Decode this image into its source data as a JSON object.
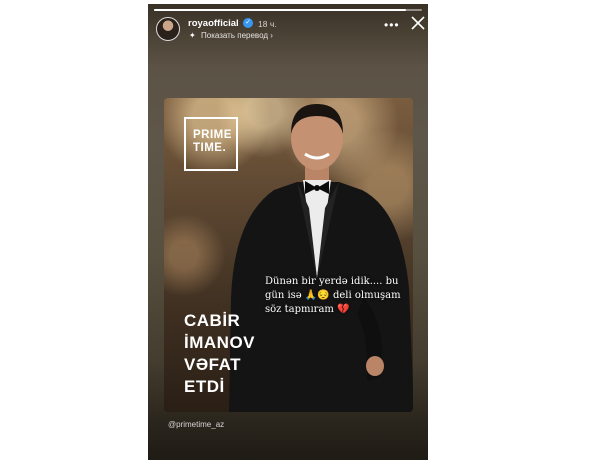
{
  "story": {
    "progress": 0.94,
    "user": {
      "name": "royaofficial",
      "verified": true
    },
    "time": "18 ч.",
    "translate_label": "Показать перевод",
    "translate_chevron": "›",
    "more_label": "•••",
    "close_icon": "close-icon",
    "verified_icon": "✓",
    "translate_icon": "✦"
  },
  "card": {
    "logo": {
      "line1": "PRIME",
      "line2": "TIME."
    },
    "headline": [
      "CABİR",
      "İMANOV",
      "VƏFAT",
      "ETDİ"
    ],
    "caption": "Dünən bir yerdə idik.... bu gün isə 🙏😔 deli olmuşam söz tapmıram 💔"
  },
  "mention": "@primetime_az"
}
